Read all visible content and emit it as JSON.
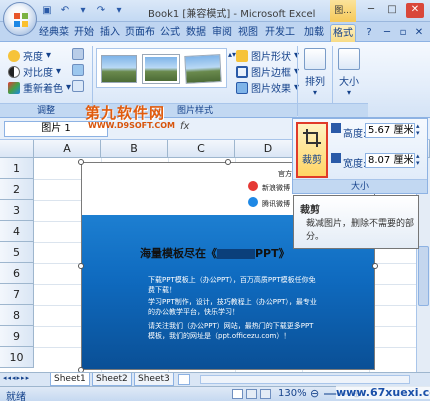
{
  "window": {
    "title": "Book1 [兼容模式] - Microsoft Excel",
    "context_tab_top": "图..."
  },
  "tabs": [
    "经典菜单",
    "开始",
    "插入",
    "页面布",
    "公式",
    "数据",
    "审阅",
    "视图",
    "开发工具",
    "加载项",
    "格式"
  ],
  "adjust_group": {
    "brightness": "亮度",
    "contrast": "对比度",
    "recolor": "重新着色",
    "label": "调整"
  },
  "styles_group": {
    "label": "图片样式",
    "shape": "图片形状",
    "border": "图片边框",
    "effects": "图片效果"
  },
  "arrange": {
    "label": "排列"
  },
  "size_btn": {
    "label": "大小"
  },
  "formula_bar": {
    "namebox": "图片 1",
    "fx": "fx"
  },
  "columns": [
    "A",
    "B",
    "C",
    "D"
  ],
  "rows": [
    "1",
    "2",
    "3",
    "4",
    "5",
    "6",
    "7",
    "8",
    "9",
    "10"
  ],
  "picture": {
    "top_text_1": "官方网址",
    "top_text_2": "新浪微博",
    "top_text_3": "腾讯微博",
    "headline": "海量模板尽在《",
    "headline_end": "PPT》",
    "bullet1": "下载PPT模板上（办公PPT），百万高质PPT模板任你免费下载！",
    "bullet2": "学习PPT制作，设计，技巧教程上（办公PPT），最专业的办公教学平台，快乐学习！",
    "bullet3": "请关注我们（办公PPT）网站，最热门的下载更多PPT模板，我们的网址是（ppt.officezu.com）！"
  },
  "watermark": {
    "line1": "第九软件网",
    "line2": "WWW.D9SOFT.COM"
  },
  "size_panel": {
    "crop": "裁剪",
    "height_label": "高度:",
    "height_value": "5.67 厘米",
    "width_label": "宽度:",
    "width_value": "8.07 厘米",
    "group_label": "大小"
  },
  "tooltip": {
    "title": "裁剪",
    "body": "裁减图片，删除不需要的部分。"
  },
  "sheets": [
    "Sheet1",
    "Sheet2",
    "Sheet3"
  ],
  "status": {
    "ready": "就绪",
    "zoom": "130%"
  },
  "site_watermark": "www.67xuexi.com"
}
